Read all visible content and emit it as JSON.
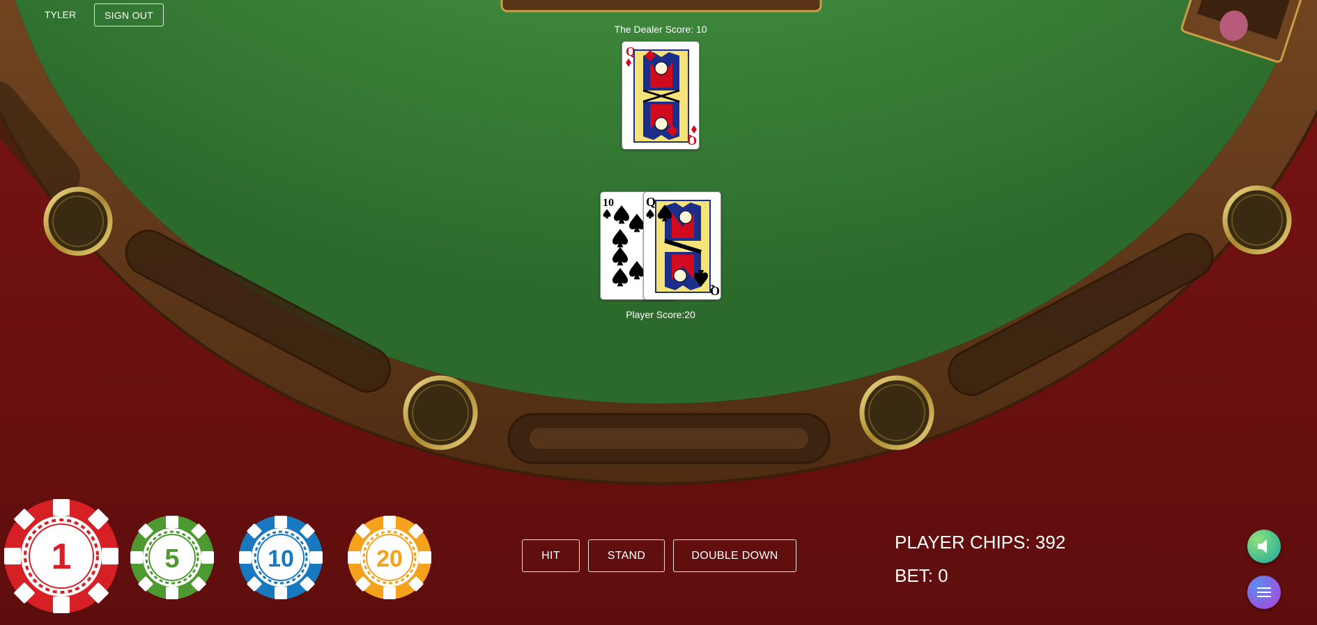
{
  "user": {
    "name": "TYLER",
    "signout_label": "SIGN OUT"
  },
  "dealer": {
    "score_label": "The Dealer Score: 10",
    "cards": [
      {
        "rank": "Q",
        "suit": "diamonds"
      }
    ]
  },
  "player": {
    "score_label": "Player Score:20",
    "cards": [
      {
        "rank": "10",
        "suit": "spades"
      },
      {
        "rank": "Q",
        "suit": "spades"
      }
    ]
  },
  "chips": [
    {
      "value": "1",
      "color": "#d71f26"
    },
    {
      "value": "5",
      "color": "#4d9a30"
    },
    {
      "value": "10",
      "color": "#1879c0"
    },
    {
      "value": "20",
      "color": "#f4a11c"
    }
  ],
  "actions": {
    "hit_label": "HIT",
    "stand_label": "STAND",
    "double_label": "DOUBLE DOWN"
  },
  "stats": {
    "chips_label": "PLAYER CHIPS: 392",
    "bet_label": "BET: 0"
  },
  "colors": {
    "felt": "#3f8a3c",
    "felt_light": "#5aa048",
    "table_red": "#6b1010",
    "rail": "#7a4a24"
  },
  "icons": {
    "sound": "speaker-icon",
    "menu": "hamburger-menu-icon"
  }
}
